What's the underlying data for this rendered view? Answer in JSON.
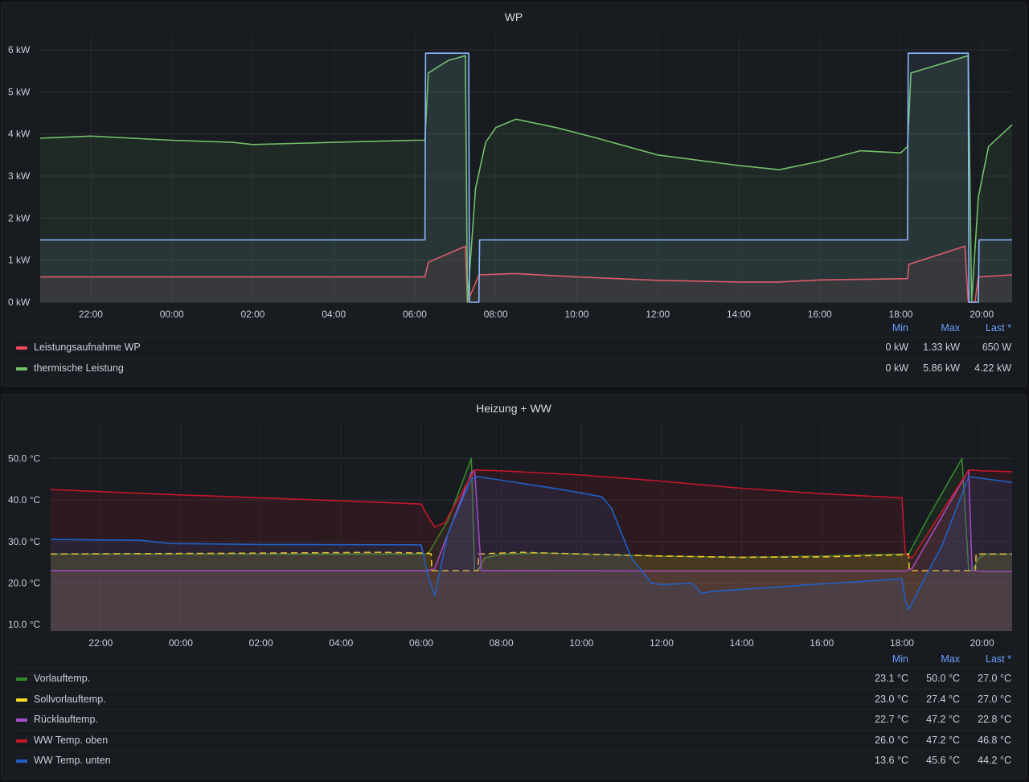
{
  "panels": [
    {
      "title": "WP",
      "y_ticks": [
        "0 kW",
        "1 kW",
        "2 kW",
        "3 kW",
        "4 kW",
        "5 kW",
        "6 kW"
      ],
      "x_ticks": [
        "22:00",
        "00:00",
        "02:00",
        "04:00",
        "06:00",
        "08:00",
        "10:00",
        "12:00",
        "14:00",
        "16:00",
        "18:00",
        "20:00"
      ],
      "legend_headers": {
        "min": "Min",
        "max": "Max",
        "last": "Last *"
      },
      "legend": [
        {
          "name": "Leistungsaufnahme WP",
          "color": "#f2495c",
          "min": "0 kW",
          "max": "1.33 kW",
          "last": "650 W"
        },
        {
          "name": "thermische Leistung",
          "color": "#73bf69",
          "min": "0 kW",
          "max": "5.86 kW",
          "last": "4.22 kW"
        }
      ]
    },
    {
      "title": "Heizung + WW",
      "y_ticks": [
        "10.0 °C",
        "20.0 °C",
        "30.0 °C",
        "40.0 °C",
        "50.0 °C"
      ],
      "x_ticks": [
        "22:00",
        "00:00",
        "02:00",
        "04:00",
        "06:00",
        "08:00",
        "10:00",
        "12:00",
        "14:00",
        "16:00",
        "18:00",
        "20:00"
      ],
      "legend_headers": {
        "min": "Min",
        "max": "Max",
        "last": "Last *"
      },
      "legend": [
        {
          "name": "Vorlauftemp.",
          "color": "#37872d",
          "min": "23.1 °C",
          "max": "50.0 °C",
          "last": "27.0 °C"
        },
        {
          "name": "Sollvorlauftemp.",
          "color": "#fade2a",
          "min": "23.0 °C",
          "max": "27.4 °C",
          "last": "27.0 °C"
        },
        {
          "name": "Rücklauftemp.",
          "color": "#a352cc",
          "min": "22.7 °C",
          "max": "47.2 °C",
          "last": "22.8 °C"
        },
        {
          "name": "WW Temp. oben",
          "color": "#c4162a",
          "min": "26.0 °C",
          "max": "47.2 °C",
          "last": "46.8 °C"
        },
        {
          "name": "WW Temp. unten",
          "color": "#1f60c4",
          "min": "13.6 °C",
          "max": "45.6 °C",
          "last": "44.2 °C"
        }
      ]
    }
  ],
  "chart_data": [
    {
      "type": "line",
      "title": "WP",
      "ylim": [
        0,
        6
      ],
      "unit": "kW",
      "x_range": [
        "20:45",
        "20:45"
      ],
      "series": [
        {
          "name": "Leistungsaufnahme WP",
          "color": "#f2495c",
          "x": [
            "20:45",
            "06:15",
            "06:20",
            "07:15",
            "07:18",
            "07:35",
            "08:30",
            "10:00",
            "12:00",
            "14:00",
            "15:00",
            "16:00",
            "18:10",
            "18:12",
            "19:35",
            "19:40",
            "19:50",
            "19:55",
            "20:45"
          ],
          "y": [
            0.6,
            0.6,
            0.95,
            1.33,
            0.0,
            0.65,
            0.68,
            0.6,
            0.52,
            0.48,
            0.48,
            0.53,
            0.56,
            0.9,
            1.33,
            0.0,
            0.0,
            0.6,
            0.65
          ]
        },
        {
          "name": "thermische Leistung",
          "color": "#73bf69",
          "x": [
            "20:45",
            "22:00",
            "00:00",
            "01:30",
            "02:00",
            "04:00",
            "06:00",
            "06:15",
            "06:20",
            "06:50",
            "07:15",
            "07:18",
            "07:30",
            "07:45",
            "08:00",
            "08:30",
            "09:30",
            "10:30",
            "12:00",
            "14:00",
            "15:00",
            "16:00",
            "17:00",
            "18:00",
            "18:10",
            "18:15",
            "19:40",
            "19:45",
            "19:55",
            "20:10",
            "20:45"
          ],
          "y": [
            3.9,
            3.95,
            3.85,
            3.8,
            3.75,
            3.8,
            3.85,
            3.85,
            5.45,
            5.75,
            5.86,
            0.0,
            2.7,
            3.8,
            4.15,
            4.35,
            4.15,
            3.9,
            3.5,
            3.25,
            3.15,
            3.35,
            3.6,
            3.55,
            3.7,
            5.45,
            5.86,
            0.0,
            2.5,
            3.7,
            4.22
          ]
        },
        {
          "color": "#8ab8ff",
          "x": [
            "20:45",
            "06:15",
            "06:16",
            "07:20",
            "07:21",
            "07:35",
            "07:36",
            "18:10",
            "18:11",
            "19:40",
            "19:41",
            "19:55",
            "19:56",
            "20:45"
          ],
          "y": [
            1.48,
            1.48,
            5.92,
            5.92,
            0.0,
            0.0,
            1.48,
            1.48,
            5.92,
            5.92,
            0.0,
            0.0,
            1.48,
            1.48
          ]
        }
      ]
    },
    {
      "type": "line",
      "title": "Heizung + WW",
      "ylim": [
        8.5,
        54.5
      ],
      "unit": "°C",
      "x_range": [
        "20:45",
        "20:45"
      ],
      "series": [
        {
          "name": "Vorlauftemp.",
          "color": "#37872d",
          "x": [
            "20:45",
            "06:00",
            "06:10",
            "06:40",
            "07:15",
            "07:20",
            "07:25",
            "07:35",
            "08:00",
            "09:00",
            "10:00",
            "12:00",
            "14:00",
            "16:00",
            "18:00",
            "18:10",
            "18:40",
            "19:30",
            "19:40",
            "19:45",
            "19:55",
            "20:05",
            "20:45"
          ],
          "y": [
            27.0,
            27.0,
            27.0,
            35.0,
            50.0,
            23.0,
            23.0,
            26.0,
            27.0,
            27.2,
            27.0,
            26.5,
            26.2,
            26.5,
            27.0,
            27.0,
            36.0,
            50.0,
            23.0,
            23.0,
            26.0,
            27.0,
            27.0
          ]
        },
        {
          "name": "Sollvorlauftemp.",
          "color": "#fade2a",
          "x": [
            "20:45",
            "02:00",
            "05:00",
            "06:10",
            "06:15",
            "06:16",
            "07:25",
            "07:26",
            "08:30",
            "10:00",
            "12:00",
            "14:00",
            "16:00",
            "18:00",
            "18:10",
            "18:11",
            "19:50",
            "19:51",
            "20:45"
          ],
          "y": [
            27.0,
            27.2,
            27.4,
            27.2,
            27.0,
            23.0,
            23.0,
            27.0,
            27.4,
            27.0,
            26.5,
            26.2,
            26.3,
            26.8,
            27.0,
            23.0,
            23.0,
            27.0,
            27.0
          ]
        },
        {
          "name": "Rücklauftemp.",
          "color": "#a352cc",
          "x": [
            "20:45",
            "06:10",
            "06:20",
            "07:15",
            "07:20",
            "07:30",
            "08:00",
            "12:00",
            "16:00",
            "18:05",
            "18:15",
            "19:40",
            "19:45",
            "20:00",
            "20:45"
          ],
          "y": [
            23.0,
            23.0,
            23.5,
            46.5,
            47.2,
            23.0,
            23.0,
            22.9,
            22.9,
            22.9,
            23.5,
            47.2,
            23.0,
            22.8,
            22.8
          ]
        },
        {
          "name": "WW Temp. oben",
          "color": "#c4162a",
          "x": [
            "20:45",
            "22:00",
            "00:00",
            "02:00",
            "04:00",
            "06:00",
            "06:10",
            "06:20",
            "06:35",
            "07:20",
            "08:00",
            "10:00",
            "12:00",
            "14:00",
            "16:00",
            "18:00",
            "18:05",
            "18:15",
            "19:40",
            "20:00",
            "20:45"
          ],
          "y": [
            42.5,
            42.0,
            41.2,
            40.5,
            39.8,
            39.0,
            36.0,
            33.5,
            34.5,
            47.2,
            47.0,
            46.0,
            44.5,
            42.8,
            41.5,
            40.5,
            27.0,
            26.0,
            47.2,
            47.0,
            46.8
          ]
        },
        {
          "name": "WW Temp. unten",
          "color": "#1f60c4",
          "x": [
            "20:45",
            "23:00",
            "23:45",
            "02:00",
            "06:00",
            "06:10",
            "06:20",
            "06:40",
            "07:15",
            "07:25",
            "08:30",
            "09:30",
            "10:30",
            "10:45",
            "11:00",
            "11:15",
            "11:30",
            "11:45",
            "12:00",
            "12:45",
            "13:00",
            "13:15",
            "14:00",
            "16:00",
            "18:00",
            "18:05",
            "18:10",
            "18:30",
            "19:00",
            "19:40",
            "20:45"
          ],
          "y": [
            30.5,
            30.3,
            29.5,
            29.3,
            29.2,
            22.0,
            17.0,
            32.0,
            45.0,
            45.6,
            44.0,
            42.5,
            40.8,
            38.0,
            32.0,
            26.0,
            23.0,
            20.0,
            19.6,
            20.0,
            17.5,
            18.0,
            18.5,
            19.8,
            21.0,
            16.0,
            13.6,
            20.0,
            29.0,
            45.6,
            44.2
          ]
        }
      ]
    }
  ]
}
